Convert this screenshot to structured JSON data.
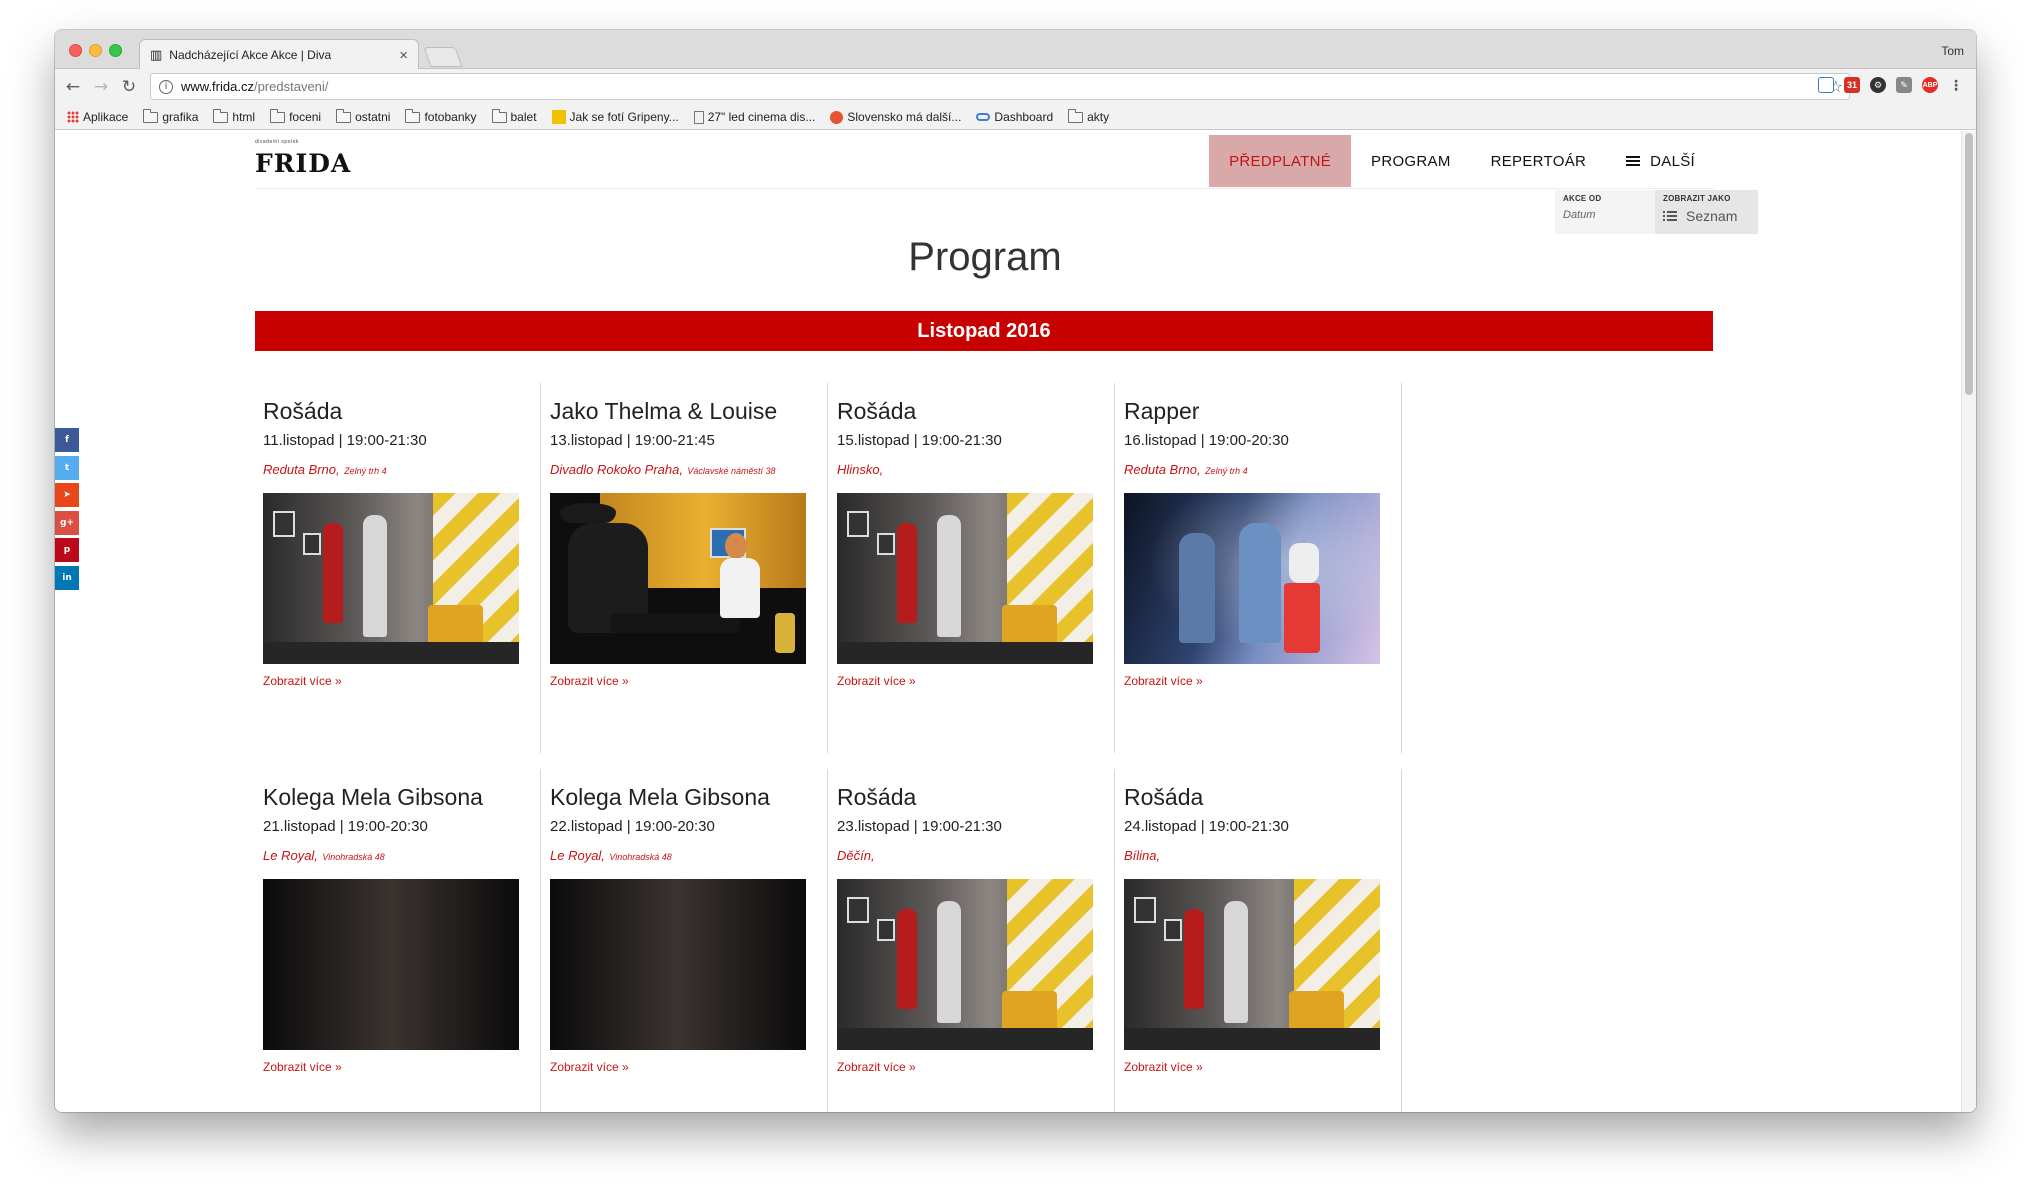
{
  "browser": {
    "tab_title": "Nadcházející Akce Akce | Diva",
    "tab_favicon": "piano-keys-icon",
    "profile_name": "Tom",
    "url_host": "www.frida.cz",
    "url_path": "/predstaveni/",
    "bookmarks": [
      {
        "label": "Aplikace",
        "icon": "apps"
      },
      {
        "label": "grafika",
        "icon": "folder"
      },
      {
        "label": "html",
        "icon": "folder"
      },
      {
        "label": "foceni",
        "icon": "folder"
      },
      {
        "label": "ostatni",
        "icon": "folder"
      },
      {
        "label": "fotobanky",
        "icon": "folder"
      },
      {
        "label": "balet",
        "icon": "folder"
      },
      {
        "label": "Jak se fotí Gripeny...",
        "icon": "yellow"
      },
      {
        "label": "27\" led cinema dis...",
        "icon": "page"
      },
      {
        "label": "Slovensko má další...",
        "icon": "red-circle"
      },
      {
        "label": "Dashboard",
        "icon": "dashboard"
      },
      {
        "label": "akty",
        "icon": "folder"
      }
    ]
  },
  "site": {
    "logo_tagline": "divadelní spolek",
    "logo_word": "FRIDA",
    "nav": [
      {
        "label": "PŘEDPLATNÉ",
        "active": true
      },
      {
        "label": "PROGRAM",
        "active": false
      },
      {
        "label": "REPERTOÁR",
        "active": false
      }
    ],
    "nav_more_label": "DALŠÍ",
    "filters": {
      "date_label": "AKCE OD",
      "date_value": "Datum",
      "view_label": "ZOBRAZIT JAKO",
      "view_value": "Seznam"
    },
    "page_title": "Program",
    "month_banner": "Listopad 2016",
    "more_label": "Zobrazit více »",
    "social": [
      "f",
      "t",
      "➤",
      "g+",
      "p",
      "in"
    ],
    "social_colors": [
      "#3b5998",
      "#55acee",
      "#e8471c",
      "#dc4e41",
      "#bd081c",
      "#0077b5"
    ],
    "accent_color": "#c80000",
    "events": [
      {
        "name": "Rošáda",
        "date": "11.listopad | 19:00-21:30",
        "venue": "Reduta Brno,",
        "address": "Zelný trh 4",
        "photo": "rosada"
      },
      {
        "name": "Jako Thelma & Louise",
        "date": "13.listopad | 19:00-21:45",
        "venue": "Divadlo Rokoko Praha,",
        "address": "Václavské náměstí 38",
        "photo": "thelma"
      },
      {
        "name": "Rošáda",
        "date": "15.listopad | 19:00-21:30",
        "venue": "Hlinsko,",
        "address": "",
        "photo": "rosada"
      },
      {
        "name": "Rapper",
        "date": "16.listopad | 19:00-20:30",
        "venue": "Reduta Brno,",
        "address": "Zelný trh 4",
        "photo": "rapper"
      },
      {
        "name": "Kolega Mela Gibsona",
        "date": "21.listopad | 19:00-20:30",
        "venue": "Le Royal,",
        "address": "Vinohradská 48",
        "photo": "dark"
      },
      {
        "name": "Kolega Mela Gibsona",
        "date": "22.listopad | 19:00-20:30",
        "venue": "Le Royal,",
        "address": "Vinohradská 48",
        "photo": "dark"
      },
      {
        "name": "Rošáda",
        "date": "23.listopad | 19:00-21:30",
        "venue": "Děčín,",
        "address": "",
        "photo": "rosada"
      },
      {
        "name": "Rošáda",
        "date": "24.listopad | 19:00-21:30",
        "venue": "Bílina,",
        "address": "",
        "photo": "rosada"
      }
    ]
  }
}
